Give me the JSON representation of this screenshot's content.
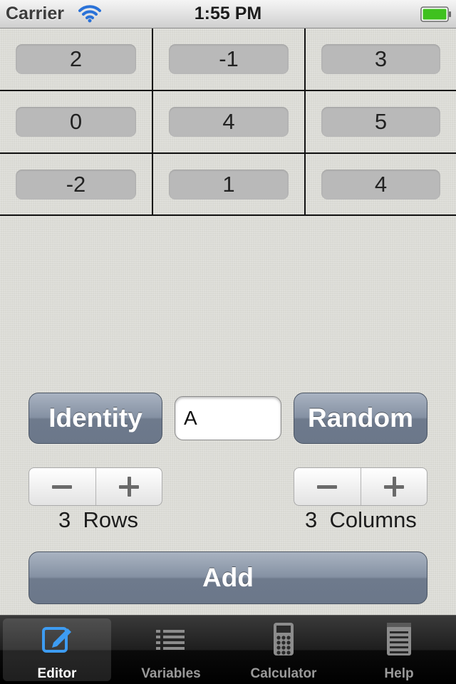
{
  "status_bar": {
    "carrier": "Carrier",
    "time": "1:55 PM",
    "wifi_icon": "wifi-icon",
    "battery_icon": "battery-full-icon",
    "battery_color": "#3fc11f"
  },
  "matrix": {
    "rows": [
      [
        "2",
        "-1",
        "3"
      ],
      [
        "0",
        "4",
        "5"
      ],
      [
        "-2",
        "1",
        "4"
      ]
    ]
  },
  "controls": {
    "identity_label": "Identity",
    "random_label": "Random",
    "matrix_name_value": "A",
    "rows_count": "3",
    "rows_label": "Rows",
    "columns_count": "3",
    "columns_label": "Columns",
    "add_label": "Add",
    "button_color": "#7c889a"
  },
  "tab_bar": {
    "tabs": [
      {
        "label": "Editor",
        "icon": "edit-icon",
        "selected": true
      },
      {
        "label": "Variables",
        "icon": "list-icon",
        "selected": false
      },
      {
        "label": "Calculator",
        "icon": "calculator-icon",
        "selected": false
      },
      {
        "label": "Help",
        "icon": "notepad-icon",
        "selected": false
      }
    ],
    "selected_color": "#3d9cf2"
  }
}
